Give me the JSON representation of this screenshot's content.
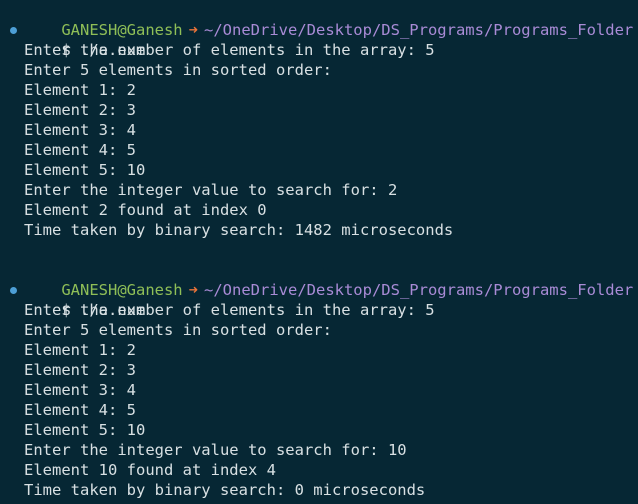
{
  "theme": {
    "background": "#062734",
    "text": "#d8e0e3",
    "user_color": "#8fbf57",
    "arrow_color": "#e8733a",
    "path_color": "#a98bd6",
    "dot_color": "#4d9fd6"
  },
  "sessions": [
    {
      "prompt": {
        "user": "GANESH@Ganesh",
        "arrow": "➜",
        "path": "~/OneDrive/Desktop/DS_Programs/Programs_Folder"
      },
      "command": "$ ./a.exe",
      "output": [
        "Enter the number of elements in the array: 5",
        "Enter 5 elements in sorted order:",
        "Element 1: 2",
        "Element 2: 3",
        "Element 3: 4",
        "Element 4: 5",
        "Element 5: 10",
        "Enter the integer value to search for: 2",
        "Element 2 found at index 0",
        "Time taken by binary search: 1482 microseconds"
      ]
    },
    {
      "prompt": {
        "user": "GANESH@Ganesh",
        "arrow": "➜",
        "path": "~/OneDrive/Desktop/DS_Programs/Programs_Folder"
      },
      "command": "$ ./a.exe",
      "output": [
        "Enter the number of elements in the array: 5",
        "Enter 5 elements in sorted order:",
        "Element 1: 2",
        "Element 2: 3",
        "Element 3: 4",
        "Element 4: 5",
        "Element 5: 10",
        "Enter the integer value to search for: 10",
        "Element 10 found at index 4",
        "Time taken by binary search: 0 microseconds"
      ]
    }
  ]
}
